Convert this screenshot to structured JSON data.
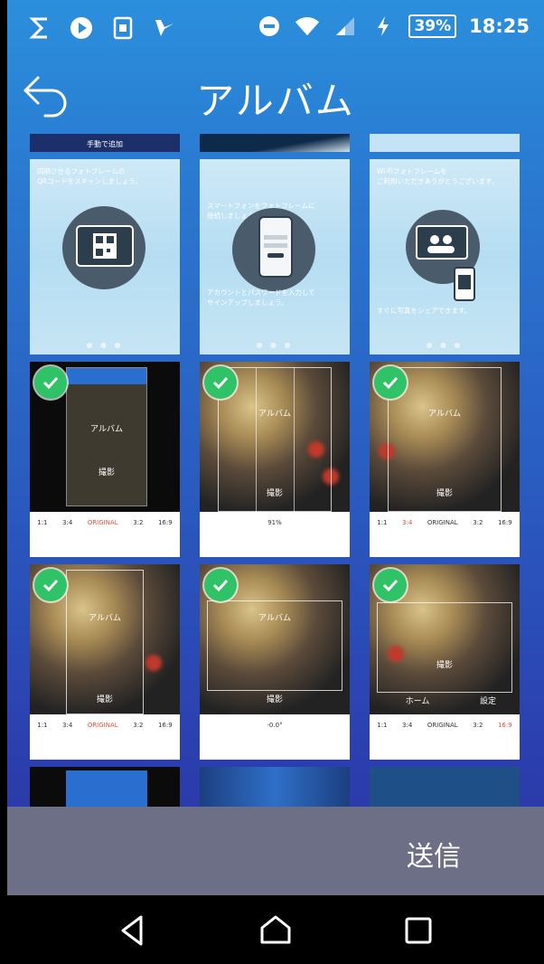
{
  "status_bar": {
    "battery": "39%",
    "time": "18:25",
    "icons": [
      "s-app-icon",
      "play-icon",
      "sim-icon",
      "check-app-icon",
      "do-not-disturb-icon",
      "wifi-icon",
      "signal-icon",
      "charging-icon"
    ]
  },
  "header": {
    "title": "アルバム",
    "back_icon": "back-arrow-icon"
  },
  "tiles": {
    "top_partial_label": "手動で追加",
    "tutorial": [
      {
        "text": "同期させるフォトフレームの\nQRコードをスキャンしましょう。"
      },
      {
        "text": "スマートフォンをフォトフレームに\n接続しましょう。",
        "caption": "アカウントとパスワードを入力して\nサインアップしましょう。"
      },
      {
        "text": "Wi-Fiフォトフレームを\nご利用いただきありがとうございます。",
        "caption": "すぐに写真をシェアできます。"
      }
    ],
    "photo_labels": {
      "album": "アルバム",
      "shoot": "撮影"
    },
    "ratios": [
      "1:1",
      "3:4",
      "ORIGINAL",
      "3:2",
      "16:9"
    ],
    "percent": "91%",
    "rotation": "-0.0°",
    "home_label": "ホーム",
    "settings_label": "設定"
  },
  "send_bar": {
    "label": "送信"
  },
  "nav_bar": {
    "icons": [
      "back-triangle-icon",
      "home-icon",
      "recents-icon"
    ]
  },
  "colors": {
    "check": "#2fc266",
    "accent_red": "#e74c3c",
    "send_bar": "#6d6f86"
  }
}
